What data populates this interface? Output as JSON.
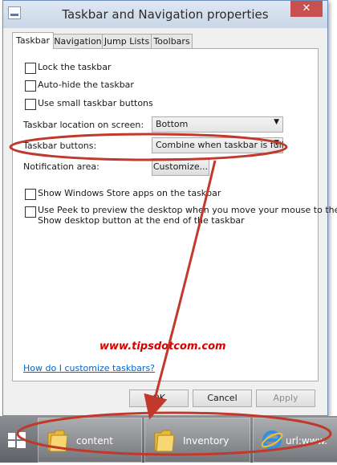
{
  "window": {
    "title": "Taskbar and Navigation properties",
    "close_glyph": "✕"
  },
  "tabs": [
    {
      "label": "Taskbar",
      "active": true
    },
    {
      "label": "Navigation",
      "active": false
    },
    {
      "label": "Jump Lists",
      "active": false
    },
    {
      "label": "Toolbars",
      "active": false
    }
  ],
  "options": {
    "lock_taskbar": {
      "label": "Lock the taskbar",
      "checked": false
    },
    "auto_hide": {
      "label": "Auto-hide the taskbar",
      "checked": false
    },
    "small_buttons": {
      "label": "Use small taskbar buttons",
      "checked": false
    },
    "store_apps": {
      "label": "Show Windows Store apps on the taskbar",
      "checked": false
    },
    "peek": {
      "label_line1": "Use Peek to preview the desktop when you move your mouse to the",
      "label_line2": "Show desktop button at the end of the taskbar",
      "checked": false
    }
  },
  "location": {
    "label": "Taskbar location on screen:",
    "value": "Bottom"
  },
  "buttons_setting": {
    "label": "Taskbar buttons:",
    "value": "Combine when taskbar is full"
  },
  "notification": {
    "label": "Notification area:",
    "button": "Customize..."
  },
  "help_link": "How do I customize taskbars?",
  "watermark": "www.tipsdotcom.com",
  "footer": {
    "ok": "OK",
    "cancel": "Cancel",
    "apply": "Apply"
  },
  "taskbar": {
    "items": [
      {
        "label": "content",
        "icon": "folder-icon"
      },
      {
        "label": "Inventory",
        "icon": "folder-icon"
      },
      {
        "label": "url:www.",
        "icon": "internet-explorer-icon"
      }
    ]
  },
  "colors": {
    "annotation": "#c0392b",
    "link": "#0066cc",
    "watermark": "#d40000"
  }
}
